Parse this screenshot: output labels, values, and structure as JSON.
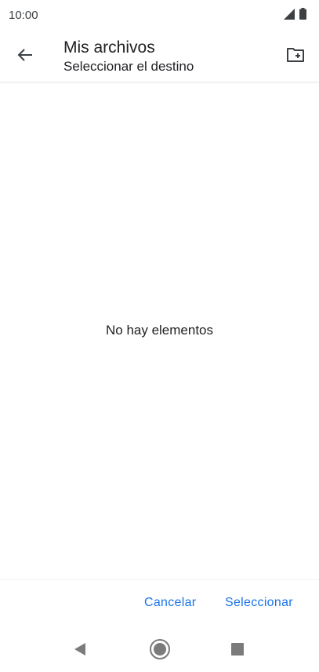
{
  "status_bar": {
    "time": "10:00",
    "icons": [
      "signal-icon",
      "battery-icon"
    ]
  },
  "app_bar": {
    "title": "Mis archivos",
    "subtitle": "Seleccionar el destino",
    "back_icon": "arrow-back-icon",
    "new_folder_icon": "create-new-folder-icon"
  },
  "content": {
    "empty_message": "No hay elementos"
  },
  "actions": {
    "cancel_label": "Cancelar",
    "select_label": "Seleccionar"
  },
  "nav_bar": {
    "icons": [
      "nav-back-icon",
      "nav-home-icon",
      "nav-recents-icon"
    ]
  },
  "colors": {
    "accent": "#1a73e8",
    "text_primary": "#202124",
    "icon": "#5f6368",
    "nav_icon": "#9e9e9e"
  }
}
